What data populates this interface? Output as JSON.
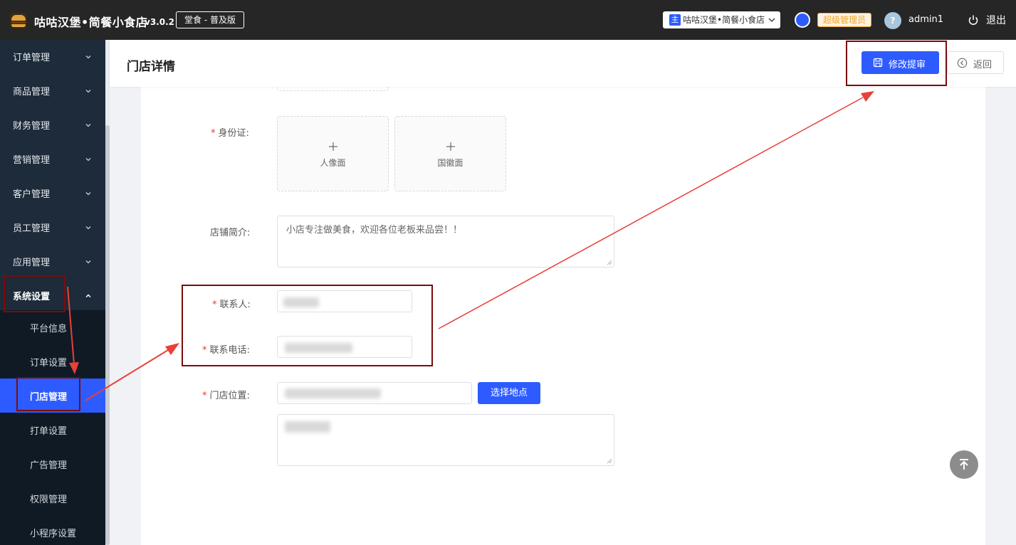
{
  "topbar": {
    "app_title": "咕咕汉堡•简餐小食店",
    "version": "v3.0.2",
    "edition": "堂食 - 普及版",
    "store_main_tag": "主",
    "store_name": "咕咕汉堡•简餐小食店",
    "role": "超级管理员",
    "avatar_glyph": "?",
    "username": "admin1",
    "logout": "退出"
  },
  "sidebar": {
    "items": [
      {
        "label": "订单管理"
      },
      {
        "label": "商品管理"
      },
      {
        "label": "财务管理"
      },
      {
        "label": "营销管理"
      },
      {
        "label": "客户管理"
      },
      {
        "label": "员工管理"
      },
      {
        "label": "应用管理"
      },
      {
        "label": "系统设置"
      }
    ],
    "submenu": [
      {
        "label": "平台信息"
      },
      {
        "label": "订单设置"
      },
      {
        "label": "门店管理"
      },
      {
        "label": "打单设置"
      },
      {
        "label": "广告管理"
      },
      {
        "label": "权限管理"
      },
      {
        "label": "小程序设置"
      }
    ]
  },
  "header": {
    "title": "门店详情",
    "submit_label": "修改提审",
    "back_label": "返回"
  },
  "form": {
    "required_mark": "*",
    "id_card_label": "身份证:",
    "id_front_label": "人像面",
    "id_back_label": "国徽面",
    "intro_label": "店铺简介:",
    "intro_value": "小店专注做美食，欢迎各位老板来品尝！！",
    "contact_label": "联系人:",
    "phone_label": "联系电话:",
    "location_label": "门店位置:",
    "pick_location_label": "选择地点"
  },
  "colors": {
    "accent": "#2e5bff",
    "sidebar_bg": "#1d2b3a",
    "topbar_bg": "#262626",
    "annotation_box": "#7a0c0c",
    "annotation_arrow": "#e8403a"
  }
}
